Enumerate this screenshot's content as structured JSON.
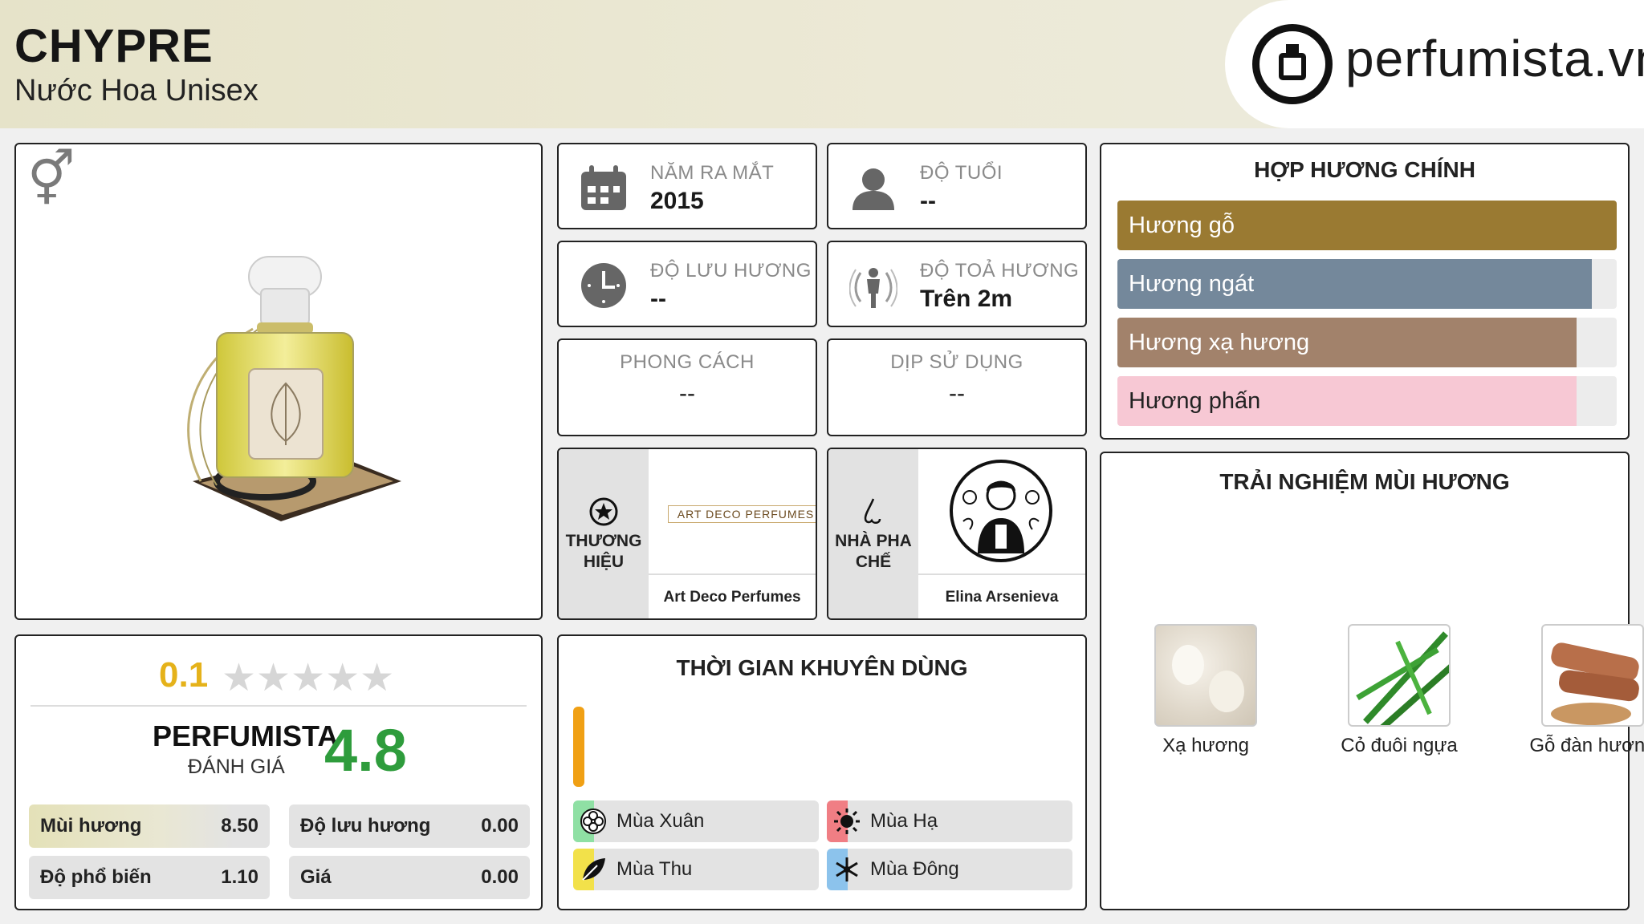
{
  "header": {
    "title": "CHYPRE",
    "subtitle": "Nước Hoa Unisex",
    "logo_text": "perfumista.vn"
  },
  "gender_icon": "unisex-icon",
  "stats": {
    "year": {
      "label": "NĂM RA MẮT",
      "value": "2015",
      "icon": "calendar-icon"
    },
    "age": {
      "label": "ĐỘ TUỔI",
      "value": "--",
      "icon": "user-icon"
    },
    "longevity": {
      "label": "ĐỘ LƯU HƯƠNG",
      "value": "--",
      "icon": "clock-icon"
    },
    "sillage": {
      "label": "ĐỘ TOẢ HƯƠNG",
      "value": "Trên 2m",
      "icon": "sillage-icon"
    },
    "style": {
      "label": "PHONG CÁCH",
      "value": "--"
    },
    "occasion": {
      "label": "DỊP SỬ DỤNG",
      "value": "--"
    }
  },
  "brand": {
    "label": "THƯƠNG HIỆU",
    "name": "Art Deco Perfumes",
    "logo_text": "ART DECO PERFUMES",
    "icon": "star-badge-icon"
  },
  "perfumer": {
    "label": "NHÀ PHA CHẾ",
    "name": "Elina Arsenieva",
    "icon": "nose-icon"
  },
  "accords": {
    "title": "HỢP HƯƠNG CHÍNH",
    "items": [
      {
        "name": "Hương gỗ",
        "level": 1.0,
        "color": "#9a7a32"
      },
      {
        "name": "Hương ngát",
        "level": 0.95,
        "color": "#74889b"
      },
      {
        "name": "Hương xạ hương",
        "level": 0.92,
        "color": "#a2826b"
      },
      {
        "name": "Hương phấn",
        "level": 0.92,
        "color": "#f7c8d4"
      }
    ]
  },
  "experience": {
    "title": "TRẢI NGHIỆM MÙI HƯƠNG",
    "items": [
      {
        "label": "Xạ hương"
      },
      {
        "label": "Cỏ đuôi ngựa"
      },
      {
        "label": "Gỗ đàn hương"
      }
    ]
  },
  "rating": {
    "star_score": "0.1",
    "stars_filled": 0,
    "stars_total": 5,
    "perfumista_label": "PERFUMISTA",
    "perfumista_sub": "ĐÁNH GIÁ",
    "perfumista_score": "4.8",
    "metrics": [
      {
        "name": "Mùi hương",
        "value": "8.50"
      },
      {
        "name": "Độ lưu hương",
        "value": "0.00"
      },
      {
        "name": "Độ phổ biến",
        "value": "1.10"
      },
      {
        "name": "Giá",
        "value": "0.00"
      }
    ]
  },
  "seasons": {
    "title": "THỜI GIAN KHUYÊN DÙNG",
    "day_night_level": 1.0,
    "items": [
      {
        "name": "Mùa Xuân",
        "icon": "flower-icon",
        "color": "#8fe0a4"
      },
      {
        "name": "Mùa Hạ",
        "icon": "sun-icon",
        "color": "#f07e84"
      },
      {
        "name": "Mùa Thu",
        "icon": "leaf-icon",
        "color": "#f2e14a"
      },
      {
        "name": "Mùa Đông",
        "icon": "snowflake-icon",
        "color": "#8cc3ec"
      }
    ]
  }
}
